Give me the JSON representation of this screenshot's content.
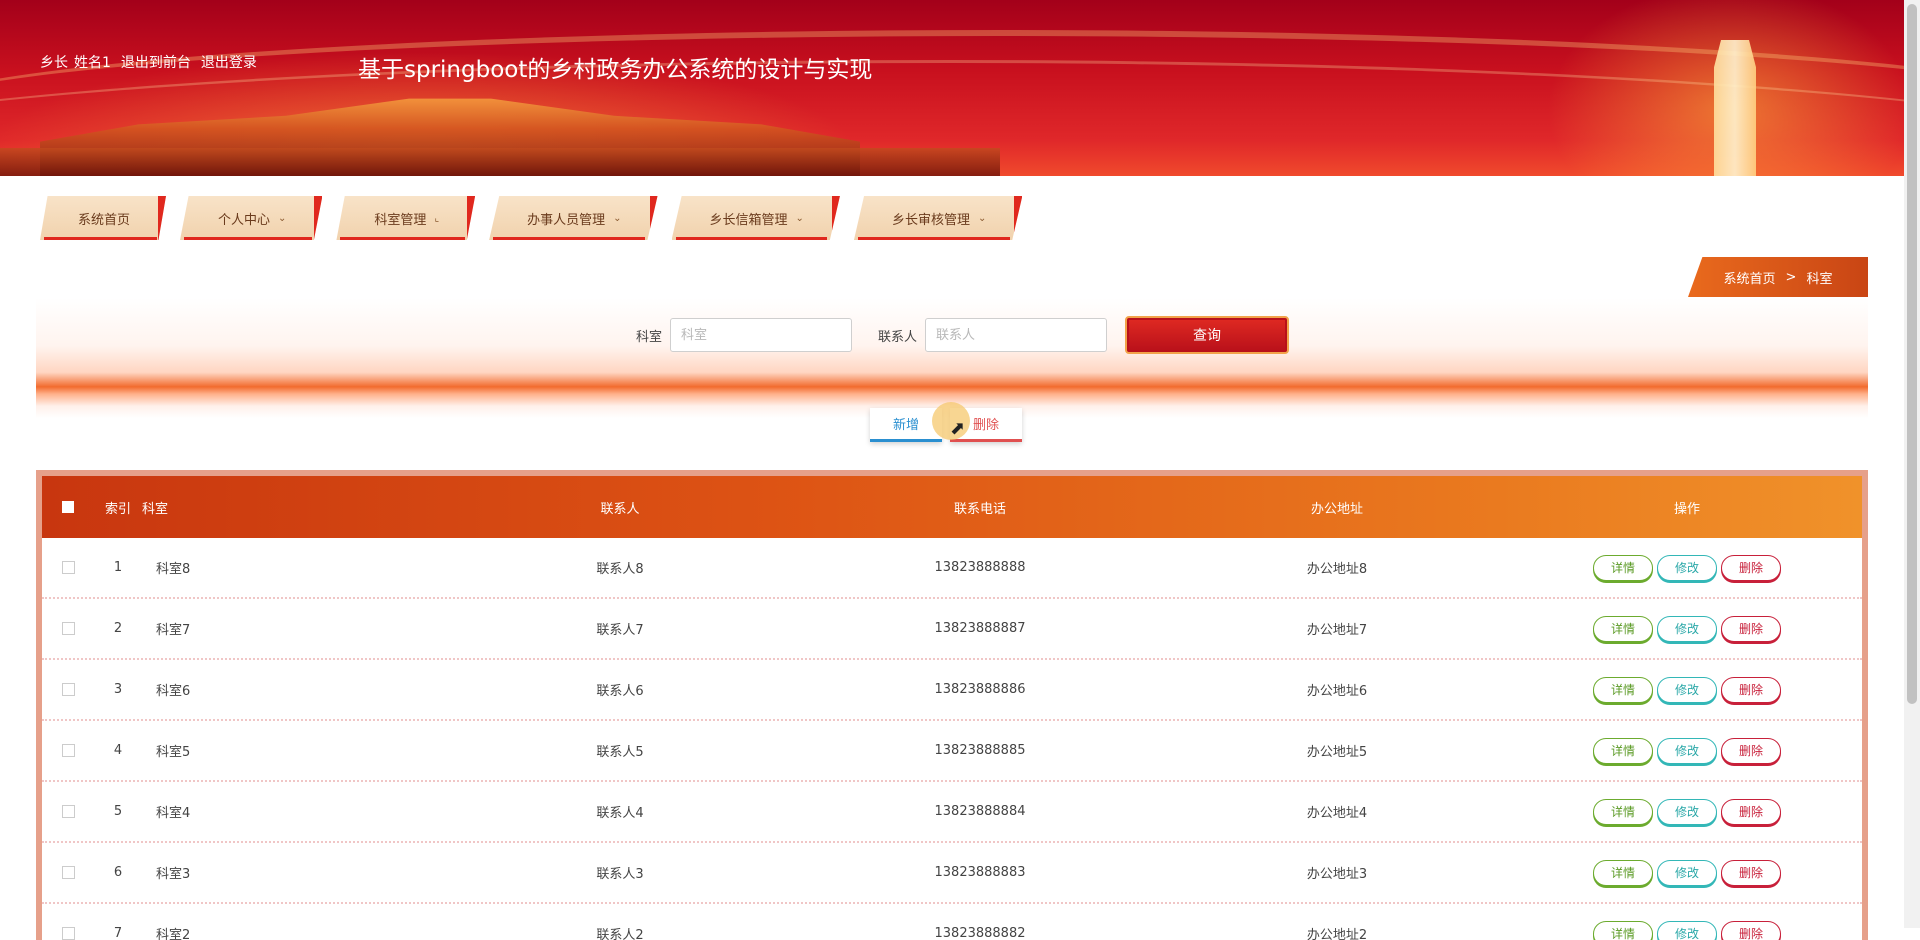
{
  "header": {
    "user_role": "乡长",
    "user_name": "姓名1",
    "to_front_label": "退出到前台",
    "logout_label": "退出登录",
    "site_title": "基于springboot的乡村政务办公系统的设计与实现"
  },
  "nav": {
    "items": [
      {
        "label": "系统首页"
      },
      {
        "label": "个人中心"
      },
      {
        "label": "科室管理"
      },
      {
        "label": "办事人员管理"
      },
      {
        "label": "乡长信箱管理"
      },
      {
        "label": "乡长审核管理"
      }
    ]
  },
  "breadcrumb": {
    "home": "系统首页",
    "separator": ">",
    "current": "科室"
  },
  "search": {
    "dept_label": "科室",
    "dept_placeholder": "科室",
    "contact_label": "联系人",
    "contact_placeholder": "联系人",
    "query_label": "查询"
  },
  "actions": {
    "add_label": "新增",
    "delete_label": "删除"
  },
  "table": {
    "headers": {
      "index": "索引",
      "dept": "科室",
      "contact": "联系人",
      "phone": "联系电话",
      "address": "办公地址",
      "ops": "操作"
    },
    "op_labels": {
      "detail": "详情",
      "edit": "修改",
      "delete": "删除"
    },
    "rows": [
      {
        "index": "1",
        "dept": "科室8",
        "contact": "联系人8",
        "phone": "13823888888",
        "address": "办公地址8"
      },
      {
        "index": "2",
        "dept": "科室7",
        "contact": "联系人7",
        "phone": "13823888887",
        "address": "办公地址7"
      },
      {
        "index": "3",
        "dept": "科室6",
        "contact": "联系人6",
        "phone": "13823888886",
        "address": "办公地址6"
      },
      {
        "index": "4",
        "dept": "科室5",
        "contact": "联系人5",
        "phone": "13823888885",
        "address": "办公地址5"
      },
      {
        "index": "5",
        "dept": "科室4",
        "contact": "联系人4",
        "phone": "13823888884",
        "address": "办公地址4"
      },
      {
        "index": "6",
        "dept": "科室3",
        "contact": "联系人3",
        "phone": "13823888883",
        "address": "办公地址3"
      },
      {
        "index": "7",
        "dept": "科室2",
        "contact": "联系人2",
        "phone": "13823888882",
        "address": "办公地址2"
      }
    ]
  },
  "colors": {
    "banner_red": "#c8101e",
    "accent_orange": "#e96a1d",
    "detail_green": "#6cab2e",
    "edit_teal": "#33b7b7",
    "delete_red": "#c8203a"
  },
  "icons": {
    "nav_chevron": "chevron-down-icon",
    "cursor": "mouse-pointer-icon"
  }
}
